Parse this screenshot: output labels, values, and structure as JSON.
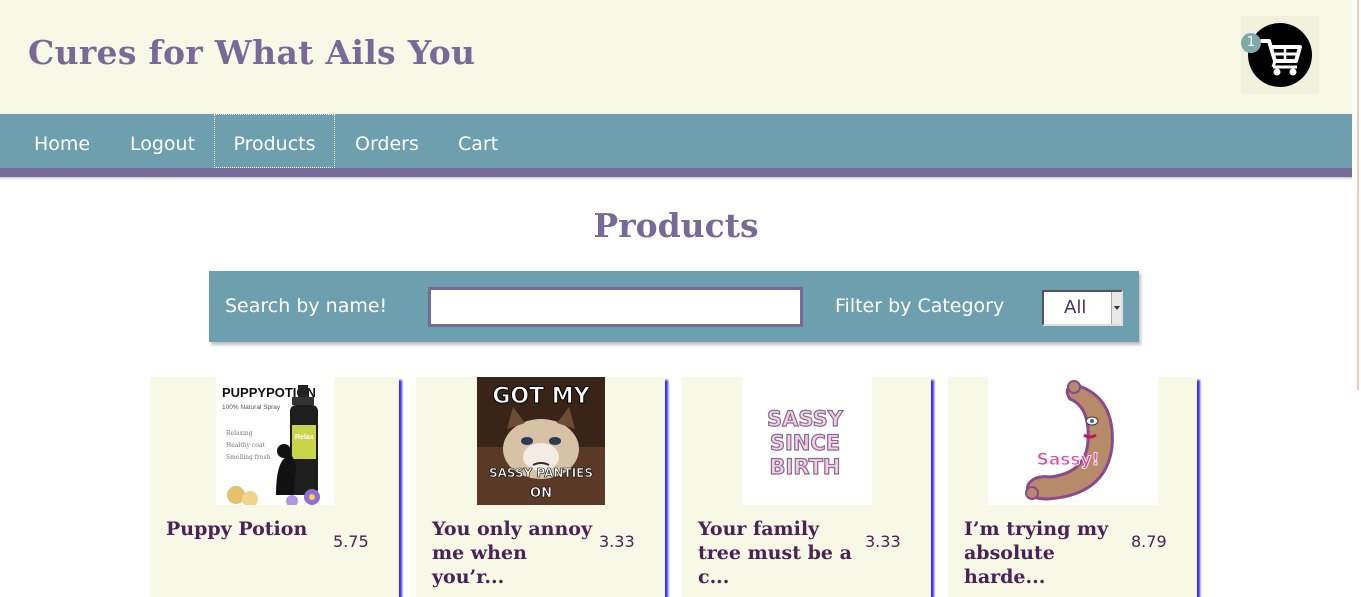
{
  "header": {
    "site_title": "Cures for What Ails You",
    "cart_count": "1",
    "cart_icon": "shopping-cart-icon"
  },
  "nav": {
    "items": [
      {
        "label": "Home"
      },
      {
        "label": "Logout"
      },
      {
        "label": "Products"
      },
      {
        "label": "Orders"
      },
      {
        "label": "Cart"
      }
    ],
    "focused": "Products"
  },
  "main": {
    "heading": "Products",
    "search": {
      "label": "Search by name!",
      "value": "",
      "placeholder": ""
    },
    "filter": {
      "label": "Filter by Category",
      "selected": "All"
    },
    "products": [
      {
        "name": "Puppy Potion",
        "price": "5.75",
        "image_text": [
          "PUPPYPOTION",
          "100% Natural Spray",
          "Relaxing",
          "Healthy coat",
          "Smelling fresh",
          "Relax"
        ]
      },
      {
        "name": "You only annoy me when you’r...",
        "price": "3.33",
        "image_text": [
          "GOT MY",
          "SASSY PANTIES",
          "ON"
        ]
      },
      {
        "name": "Your family tree must be a c...",
        "price": "3.33",
        "image_text": [
          "SASSY",
          "SINCE",
          "BIRTH"
        ]
      },
      {
        "name": "I’m trying my absolute harde...",
        "price": "8.79",
        "image_text": [
          "Sassy!"
        ]
      }
    ]
  },
  "colors": {
    "header_bg": "#f8f8e6",
    "nav_bg": "#6e9fae",
    "accent_purple": "#776a99",
    "card_shadow": "#3b2cf0",
    "product_text": "#4a2256"
  }
}
